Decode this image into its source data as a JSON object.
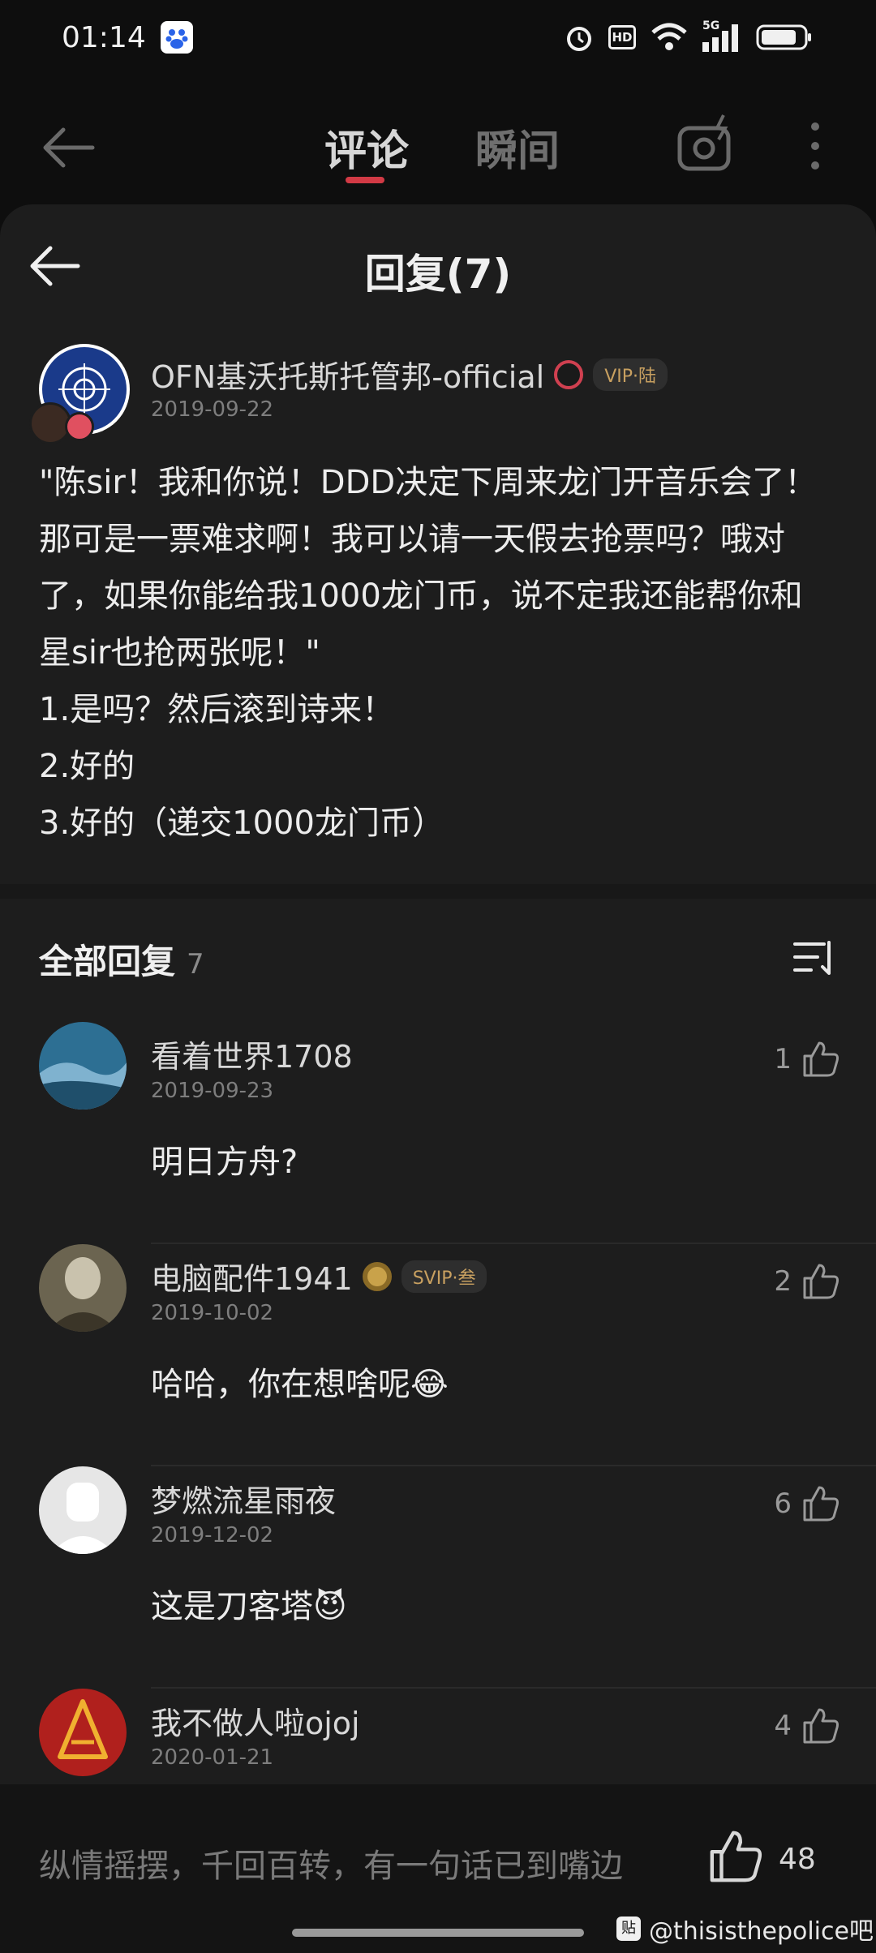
{
  "status_bar": {
    "time": "01:14",
    "icons": [
      "baidu-app-icon",
      "alarm-icon",
      "hd-icon",
      "wifi-icon",
      "signal-5g-icon",
      "battery-icon"
    ],
    "hd_label": "HD",
    "network_label": "5G"
  },
  "top_bar": {
    "tabs": [
      {
        "label": "评论",
        "active": true
      },
      {
        "label": "瞬间",
        "active": false
      }
    ],
    "accent": "#d23a45"
  },
  "sheet": {
    "title": "回复(7)"
  },
  "main_comment": {
    "username": "OFN基沃托斯托管邦-official",
    "vip_label": "VIP·陆",
    "date": "2019-09-22",
    "lines": [
      "\"陈sir！我和你说！DDD决定下周来龙门开音乐会了！",
      "那可是一票难求啊！我可以请一天假去抢票吗？哦对",
      "了，如果你能给我1000龙门币，说不定我还能帮你和",
      "星sir也抢两张呢！\"",
      "1.是吗？然后滚到诗来！",
      "2.好的",
      "3.好的（递交1000龙门币）"
    ]
  },
  "all_replies": {
    "title": "全部回复",
    "count": "7"
  },
  "replies": [
    {
      "username": "看着世界1708",
      "badge": "",
      "date": "2019-09-23",
      "text": "明日方舟?",
      "likes": "1",
      "avatar_color": "#2d6f93"
    },
    {
      "username": "电脑配件1941",
      "badge": "SVIP·叁",
      "date": "2019-10-02",
      "text": "哈哈，你在想啥呢😂",
      "likes": "2",
      "avatar_color": "#6b6450"
    },
    {
      "username": "梦燃流星雨夜",
      "badge": "",
      "date": "2019-12-02",
      "text": "这是刀客塔😈",
      "likes": "6",
      "avatar_color": "#e6e6e6"
    },
    {
      "username": "我不做人啦ojoj",
      "badge": "",
      "date": "2020-01-21",
      "text": "",
      "likes": "4",
      "avatar_color": "#b0201d"
    }
  ],
  "bottom_bar": {
    "input_placeholder": "纵情摇摆，千回百转，有一句话已到嘴边",
    "like_count": "48",
    "watermark_badge": "贴",
    "watermark_text": "@thisisthepolice吧"
  }
}
